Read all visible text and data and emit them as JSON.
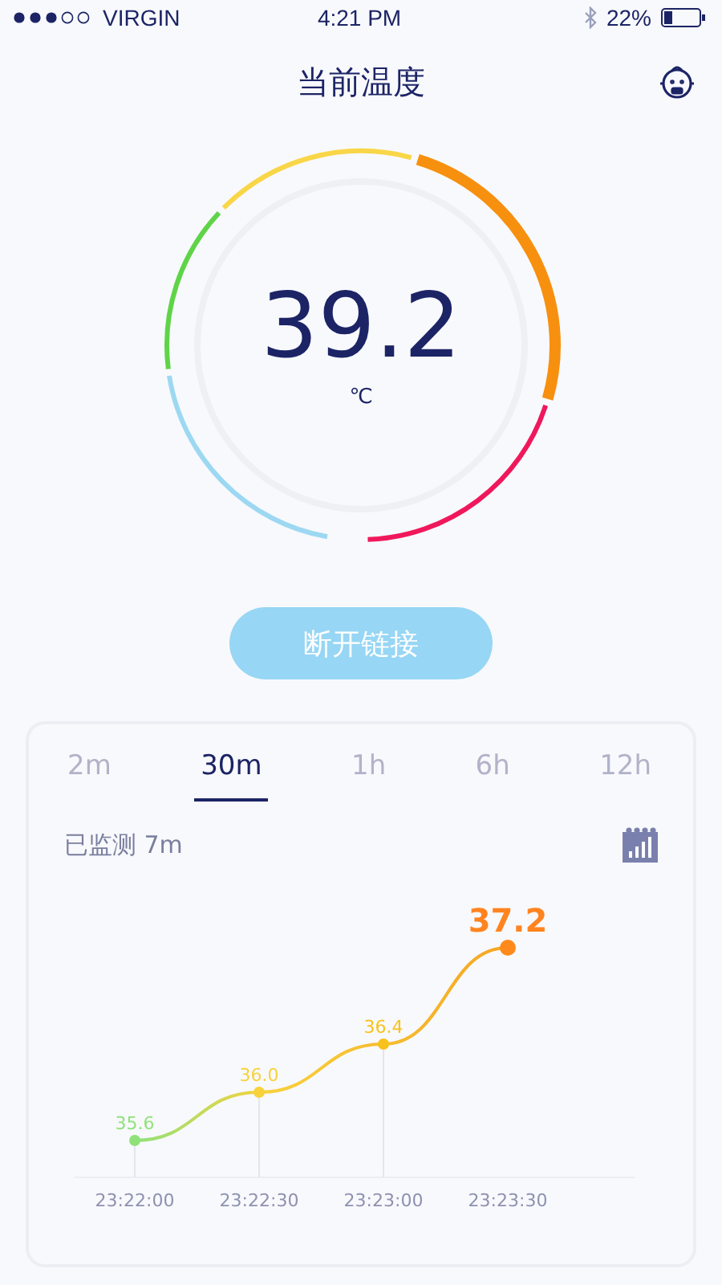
{
  "status_bar": {
    "carrier": "VIRGIN",
    "time": "4:21 PM",
    "battery": "22%"
  },
  "header": {
    "title": "当前温度"
  },
  "gauge": {
    "value": "39.2",
    "unit": "℃"
  },
  "disconnect_button": "断开链接",
  "history": {
    "tabs": [
      {
        "label": "2m",
        "selected": false
      },
      {
        "label": "30m",
        "selected": true
      },
      {
        "label": "1h",
        "selected": false
      },
      {
        "label": "6h",
        "selected": false
      },
      {
        "label": "12h",
        "selected": false
      }
    ],
    "monitored": "已监测 7m",
    "chart_data": {
      "type": "line",
      "categories": [
        "23:22:00",
        "23:22:30",
        "23:23:00",
        "23:23:30"
      ],
      "series": [
        {
          "color": "#f5a623",
          "marker": true,
          "values": [
            35.6,
            36.0,
            36.4,
            37.2
          ],
          "value_labels": [
            "35.6",
            "36.0",
            "36.4",
            "37.2"
          ]
        }
      ],
      "data_labels": true
    }
  }
}
